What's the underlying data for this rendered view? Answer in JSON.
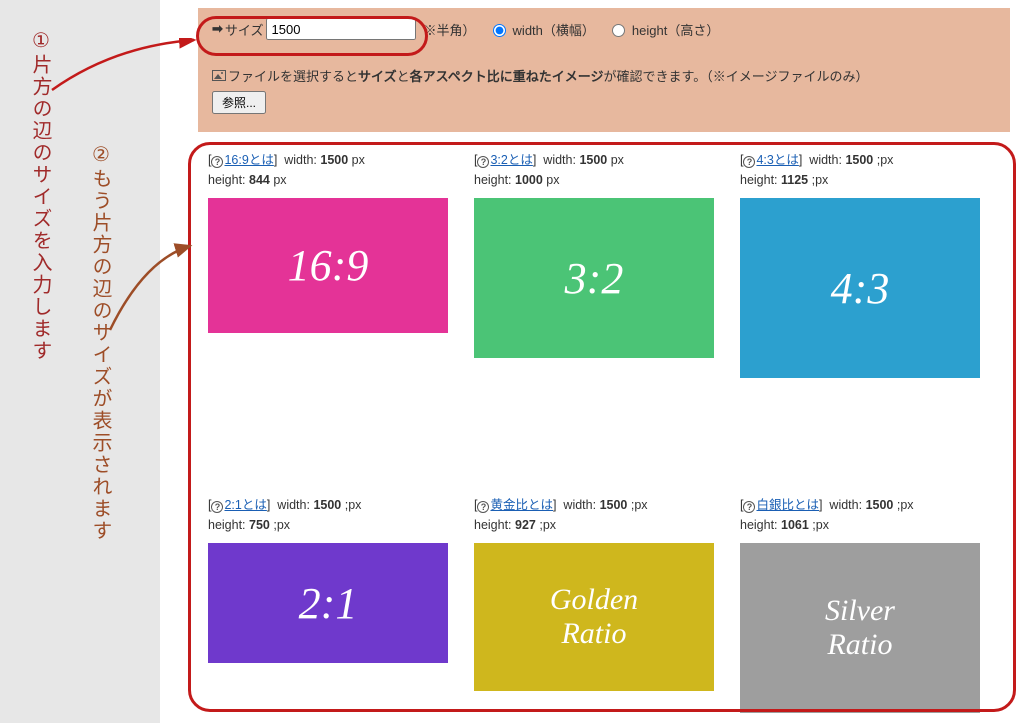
{
  "top": {
    "size_label": "サイズ",
    "size_value": "1500",
    "hankaku_note": "※半角）",
    "radio_width": "width（横幅）",
    "radio_height": "height（高さ）",
    "file_line_pre": "ファイルを選択すると ",
    "file_line_b1": "サイズ",
    "file_line_mid": " と ",
    "file_line_b2": "各アスペクト比に重ねたイメージ",
    "file_line_post": " が確認できます。（※イメージファイルのみ）",
    "browse_label": "参照..."
  },
  "anno": {
    "l1_num": "①",
    "l1_text": "片方の辺のサイズを入力します",
    "l2_num": "②",
    "l2_text": "もう片方の辺のサイズが表示されます"
  },
  "tiles": [
    {
      "link": "16:9とは",
      "w_label": "width:",
      "w_val": "1500",
      "w_unit": " px",
      "h_label": "height:",
      "h_val": "844",
      "h_unit": " px",
      "box_text": "16:9",
      "cls": "r169"
    },
    {
      "link": "3:2とは",
      "w_label": "width:",
      "w_val": "1500",
      "w_unit": " px",
      "h_label": "height:",
      "h_val": "1000",
      "h_unit": " px",
      "box_text": "3:2",
      "cls": "r32"
    },
    {
      "link": "4:3とは",
      "w_label": "width:",
      "w_val": "1500",
      "w_unit": " ;px",
      "h_label": "height:",
      "h_val": "1125",
      "h_unit": " ;px",
      "box_text": "4:3",
      "cls": "r43"
    },
    {
      "link": "2:1とは",
      "w_label": "width:",
      "w_val": "1500",
      "w_unit": " ;px",
      "h_label": "height:",
      "h_val": "750",
      "h_unit": " ;px",
      "box_text": "2:1",
      "cls": "r21"
    },
    {
      "link": "黄金比とは",
      "w_label": "width:",
      "w_val": "1500",
      "w_unit": " ;px",
      "h_label": "height:",
      "h_val": "927",
      "h_unit": " ;px",
      "box_text": "Golden\nRatio",
      "cls": "rgold"
    },
    {
      "link": "白銀比とは",
      "w_label": "width:",
      "w_val": "1500",
      "w_unit": " ;px",
      "h_label": "height:",
      "h_val": "1061",
      "h_unit": " ;px",
      "box_text": "Silver\nRatio",
      "cls": "rsilv"
    }
  ]
}
